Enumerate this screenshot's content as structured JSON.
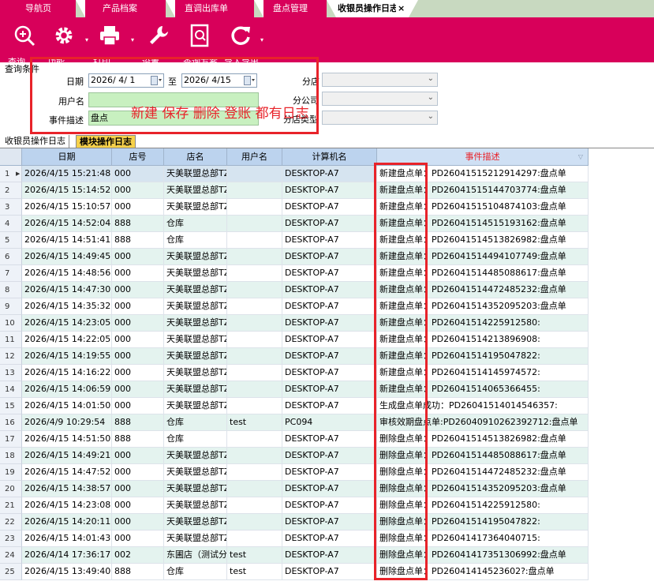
{
  "tabs": [
    {
      "label": "导航页"
    },
    {
      "label": "产品档案"
    },
    {
      "label": "直调出库单"
    },
    {
      "label": "盘点管理"
    },
    {
      "label": "收银员操作日志",
      "close": "×"
    }
  ],
  "toolbar": {
    "buttons": [
      {
        "label": "查询",
        "icon": "search-zoom-icon"
      },
      {
        "label": "功能",
        "icon": "gear-icon"
      },
      {
        "label": "打印",
        "icon": "printer-icon"
      },
      {
        "label": "设置",
        "icon": "wrench-icon"
      },
      {
        "label": "查询方案",
        "icon": "document-search-icon"
      },
      {
        "label": "导入导出",
        "icon": "refresh-icon"
      }
    ]
  },
  "filter": {
    "section_label": "查询条件",
    "date_label": "日期",
    "date_from": "2026/ 4/ 1",
    "date_to_label": "至",
    "date_to": "2026/ 4/15",
    "user_label": "用户名",
    "user_value": "",
    "event_label": "事件描述",
    "event_value": "盘点",
    "branch_label": "分店",
    "company_label": "分公司",
    "branch_type_label": "分店类型",
    "annotation": "新建 保存 删除 登账 都有日志"
  },
  "grid_tabs": [
    {
      "label": "收银员操作日志",
      "active": false
    },
    {
      "label": "模块操作日志",
      "active": true
    }
  ],
  "table": {
    "columns": [
      "日期",
      "店号",
      "店名",
      "用户名",
      "计算机名",
      "事件描述"
    ],
    "rows": [
      {
        "n": "1",
        "date": "2026/4/15 15:21:48",
        "store": "000",
        "name": "天美联盟总部TZ",
        "user": "",
        "pc": "DESKTOP-A7",
        "desc": "新建盘点单：PD26041515212914297:盘点单"
      },
      {
        "n": "2",
        "date": "2026/4/15 15:14:52",
        "store": "000",
        "name": "天美联盟总部TZ",
        "user": "",
        "pc": "DESKTOP-A7",
        "desc": "新建盘点单：PD26041515144703774:盘点单"
      },
      {
        "n": "3",
        "date": "2026/4/15 15:10:57",
        "store": "000",
        "name": "天美联盟总部TZ",
        "user": "",
        "pc": "DESKTOP-A7",
        "desc": "新建盘点单：PD26041515104874103:盘点单"
      },
      {
        "n": "4",
        "date": "2026/4/15 14:52:04",
        "store": "888",
        "name": "仓库",
        "user": "",
        "pc": "DESKTOP-A7",
        "desc": "新建盘点单：PD26041514515193162:盘点单"
      },
      {
        "n": "5",
        "date": "2026/4/15 14:51:41",
        "store": "888",
        "name": "仓库",
        "user": "",
        "pc": "DESKTOP-A7",
        "desc": "新建盘点单：PD26041514513826982:盘点单"
      },
      {
        "n": "6",
        "date": "2026/4/15 14:49:45",
        "store": "000",
        "name": "天美联盟总部TZ",
        "user": "",
        "pc": "DESKTOP-A7",
        "desc": "新建盘点单：PD26041514494107749:盘点单"
      },
      {
        "n": "7",
        "date": "2026/4/15 14:48:56",
        "store": "000",
        "name": "天美联盟总部TZ",
        "user": "",
        "pc": "DESKTOP-A7",
        "desc": "新建盘点单：PD26041514485088617:盘点单"
      },
      {
        "n": "8",
        "date": "2026/4/15 14:47:30",
        "store": "000",
        "name": "天美联盟总部TZ",
        "user": "",
        "pc": "DESKTOP-A7",
        "desc": "新建盘点单：PD26041514472485232:盘点单"
      },
      {
        "n": "9",
        "date": "2026/4/15 14:35:32",
        "store": "000",
        "name": "天美联盟总部TZ",
        "user": "",
        "pc": "DESKTOP-A7",
        "desc": "新建盘点单：PD26041514352095203:盘点单"
      },
      {
        "n": "10",
        "date": "2026/4/15 14:23:05",
        "store": "000",
        "name": "天美联盟总部TZ",
        "user": "",
        "pc": "DESKTOP-A7",
        "desc": "新建盘点单：PD26041514225912580:"
      },
      {
        "n": "11",
        "date": "2026/4/15 14:22:05",
        "store": "000",
        "name": "天美联盟总部TZ",
        "user": "",
        "pc": "DESKTOP-A7",
        "desc": "新建盘点单：PD26041514213896908:"
      },
      {
        "n": "12",
        "date": "2026/4/15 14:19:55",
        "store": "000",
        "name": "天美联盟总部TZ",
        "user": "",
        "pc": "DESKTOP-A7",
        "desc": "新建盘点单：PD26041514195047822:"
      },
      {
        "n": "13",
        "date": "2026/4/15 14:16:22",
        "store": "000",
        "name": "天美联盟总部TZ",
        "user": "",
        "pc": "DESKTOP-A7",
        "desc": "新建盘点单：PD26041514145974572:"
      },
      {
        "n": "14",
        "date": "2026/4/15 14:06:59",
        "store": "000",
        "name": "天美联盟总部TZ",
        "user": "",
        "pc": "DESKTOP-A7",
        "desc": "新建盘点单：PD26041514065366455:"
      },
      {
        "n": "15",
        "date": "2026/4/15 14:01:50",
        "store": "000",
        "name": "天美联盟总部TZ",
        "user": "",
        "pc": "DESKTOP-A7",
        "desc": "生成盘点单成功：PD26041514014546357:"
      },
      {
        "n": "16",
        "date": "2026/4/9 10:29:54",
        "store": "888",
        "name": "仓库",
        "user": "test",
        "pc": "PC094",
        "desc": "审核效期盘点单:PD26040910262392712:盘点单"
      },
      {
        "n": "17",
        "date": "2026/4/15 14:51:50",
        "store": "888",
        "name": "仓库",
        "user": "",
        "pc": "DESKTOP-A7",
        "desc": "删除盘点单：PD26041514513826982:盘点单"
      },
      {
        "n": "18",
        "date": "2026/4/15 14:49:21",
        "store": "000",
        "name": "天美联盟总部TZ",
        "user": "",
        "pc": "DESKTOP-A7",
        "desc": "删除盘点单：PD26041514485088617:盘点单"
      },
      {
        "n": "19",
        "date": "2026/4/15 14:47:52",
        "store": "000",
        "name": "天美联盟总部TZ",
        "user": "",
        "pc": "DESKTOP-A7",
        "desc": "删除盘点单：PD26041514472485232:盘点单"
      },
      {
        "n": "20",
        "date": "2026/4/15 14:38:57",
        "store": "000",
        "name": "天美联盟总部TZ",
        "user": "",
        "pc": "DESKTOP-A7",
        "desc": "删除盘点单：PD26041514352095203:盘点单"
      },
      {
        "n": "21",
        "date": "2026/4/15 14:23:08",
        "store": "000",
        "name": "天美联盟总部TZ",
        "user": "",
        "pc": "DESKTOP-A7",
        "desc": "删除盘点单：PD26041514225912580:"
      },
      {
        "n": "22",
        "date": "2026/4/15 14:20:11",
        "store": "000",
        "name": "天美联盟总部TZ",
        "user": "",
        "pc": "DESKTOP-A7",
        "desc": "删除盘点单：PD26041514195047822:"
      },
      {
        "n": "23",
        "date": "2026/4/15 14:01:43",
        "store": "000",
        "name": "天美联盟总部TZ",
        "user": "",
        "pc": "DESKTOP-A7",
        "desc": "删除盘点单：PD26041417364040715:"
      },
      {
        "n": "24",
        "date": "2026/4/14 17:36:17",
        "store": "002",
        "name": "东圃店（测试分",
        "user": "test",
        "pc": "DESKTOP-A7",
        "desc": "删除盘点单：PD26041417351306992:盘点单"
      },
      {
        "n": "25",
        "date": "2026/4/15 13:49:40",
        "store": "888",
        "name": "仓库",
        "user": "test",
        "pc": "DESKTOP-A7",
        "desc": "删除盘点单：PD26041414523602?:盘点单"
      }
    ]
  },
  "colors": {
    "accent": "#d8005a",
    "header": "#bcd3ee",
    "alt_row": "#e4f3ef",
    "annotation": "#e8232a"
  }
}
